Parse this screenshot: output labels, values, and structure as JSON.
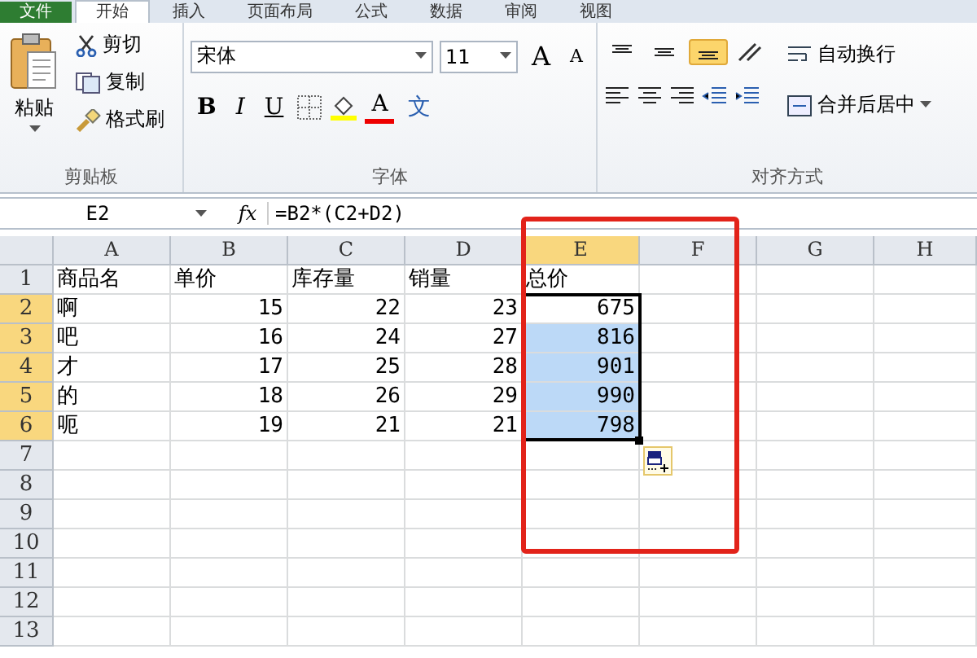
{
  "ribbon_tabs": [
    {
      "label": "文件",
      "selected": false,
      "kind": "file"
    },
    {
      "label": "开始",
      "selected": true,
      "kind": "tab"
    },
    {
      "label": "插入",
      "selected": false,
      "kind": "tab"
    },
    {
      "label": "页面布局",
      "selected": false,
      "kind": "tab"
    },
    {
      "label": "公式",
      "selected": false,
      "kind": "tab"
    },
    {
      "label": "数据",
      "selected": false,
      "kind": "tab"
    },
    {
      "label": "审阅",
      "selected": false,
      "kind": "tab"
    },
    {
      "label": "视图",
      "selected": false,
      "kind": "tab"
    }
  ],
  "clipboard": {
    "title": "剪贴板",
    "paste": "粘贴",
    "cut": "剪切",
    "copy": "复制",
    "format_painter": "格式刷"
  },
  "font": {
    "title": "字体",
    "font_name": "宋体",
    "font_size": "11",
    "grow": "A",
    "shrink": "A",
    "bold": "B",
    "italic": "I",
    "underline": "U",
    "font_color": "A",
    "phonetic": "文"
  },
  "alignment": {
    "title": "对齐方式",
    "vertical": [
      {
        "selected": false
      },
      {
        "selected": false
      },
      {
        "selected": true
      }
    ],
    "wrap_text": "自动换行",
    "merge_center": "合并后居中"
  },
  "formula_bar": {
    "name_box": "E2",
    "fx": "fx",
    "formula": "=B2*(C2+D2)"
  },
  "columns": [
    {
      "label": "A",
      "selected": false
    },
    {
      "label": "B",
      "selected": false
    },
    {
      "label": "C",
      "selected": false
    },
    {
      "label": "D",
      "selected": false
    },
    {
      "label": "E",
      "selected": true
    },
    {
      "label": "F",
      "selected": false
    },
    {
      "label": "G",
      "selected": false
    },
    {
      "label": "H",
      "selected": false
    }
  ],
  "rows": [
    {
      "number": "1",
      "selected": false,
      "highlighted": false,
      "cells": [
        "商品名",
        "单价",
        "库存量",
        "销量",
        "总价"
      ]
    },
    {
      "number": "2",
      "selected": true,
      "highlighted": false,
      "cells": [
        "啊",
        "15",
        "22",
        "23",
        "675"
      ]
    },
    {
      "number": "3",
      "selected": true,
      "highlighted": true,
      "cells": [
        "吧",
        "16",
        "24",
        "27",
        "816"
      ]
    },
    {
      "number": "4",
      "selected": true,
      "highlighted": true,
      "cells": [
        "才",
        "17",
        "25",
        "28",
        "901"
      ]
    },
    {
      "number": "5",
      "selected": true,
      "highlighted": true,
      "cells": [
        "的",
        "18",
        "26",
        "29",
        "990"
      ]
    },
    {
      "number": "6",
      "selected": true,
      "highlighted": true,
      "cells": [
        "呃",
        "19",
        "21",
        "21",
        "798"
      ]
    },
    {
      "number": "7",
      "selected": false,
      "highlighted": false,
      "cells": []
    },
    {
      "number": "8",
      "selected": false,
      "highlighted": false,
      "cells": []
    },
    {
      "number": "9",
      "selected": false,
      "highlighted": false,
      "cells": []
    },
    {
      "number": "10",
      "selected": false,
      "highlighted": false,
      "cells": []
    },
    {
      "number": "11",
      "selected": false,
      "highlighted": false,
      "cells": []
    },
    {
      "number": "12",
      "selected": false,
      "highlighted": false,
      "cells": []
    },
    {
      "number": "13",
      "selected": false,
      "highlighted": false,
      "cells": []
    }
  ]
}
